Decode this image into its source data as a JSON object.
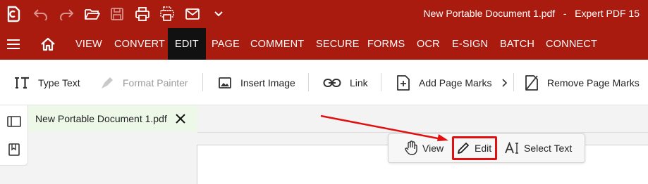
{
  "window": {
    "title": "New Portable Document 1.pdf   -   Expert PDF 15",
    "brand_color": "#a91a0f"
  },
  "quick_access": {
    "icons": [
      "app-logo-icon",
      "undo-icon",
      "redo-icon",
      "open-folder-icon",
      "save-icon",
      "print-icon",
      "batch-print-icon",
      "email-icon",
      "chevron-down-icon"
    ]
  },
  "ribbon": {
    "tabs": [
      {
        "label": "VIEW"
      },
      {
        "label": "CONVERT"
      },
      {
        "label": "EDIT",
        "active": true
      },
      {
        "label": "PAGE"
      },
      {
        "label": "COMMENT"
      },
      {
        "label": "SECURE"
      },
      {
        "label": "FORMS"
      },
      {
        "label": "OCR"
      },
      {
        "label": "E-SIGN"
      },
      {
        "label": "BATCH"
      },
      {
        "label": "CONNECT"
      }
    ]
  },
  "toolbar": {
    "type_text": "Type Text",
    "format_painter": "Format Painter",
    "insert_image": "Insert Image",
    "link": "Link",
    "add_page_marks": "Add Page Marks",
    "remove_page_marks": "Remove Page Marks"
  },
  "document_tab": {
    "name": "New Portable Document 1.pdf"
  },
  "mode_bar": {
    "view": "View",
    "edit": "Edit",
    "select_text": "Select Text"
  },
  "annotation": {
    "highlight_color": "#e01010"
  }
}
